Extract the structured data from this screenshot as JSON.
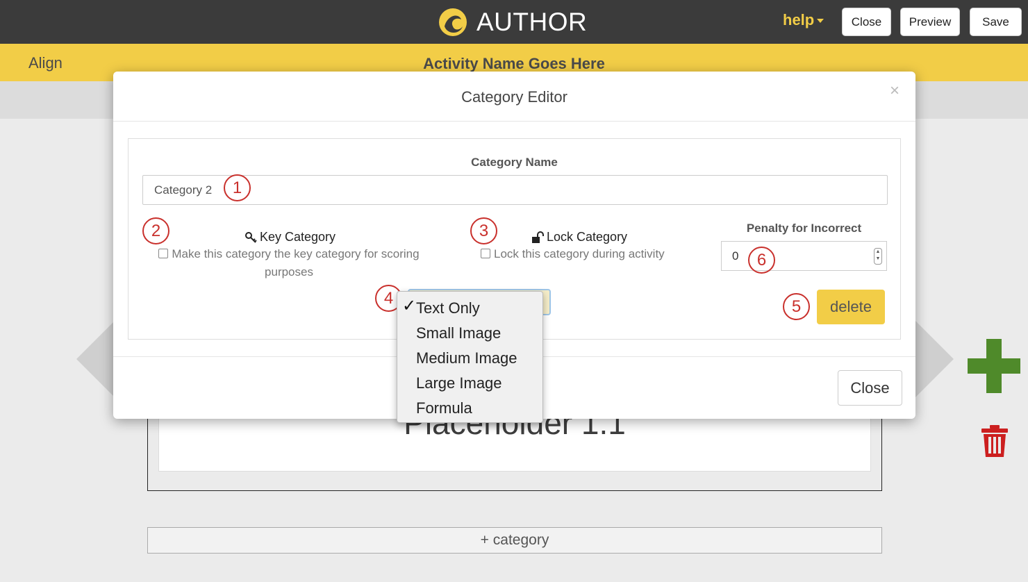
{
  "header": {
    "brand": "AUTHOR",
    "help_label": "help",
    "buttons": {
      "close": "Close",
      "preview": "Preview",
      "save": "Save"
    },
    "accent_color": "#f2cd47"
  },
  "subheader": {
    "app_label": "Align",
    "activity_name": "Activity Name Goes Here"
  },
  "background": {
    "placeholder_text": "Placeholder 1.1",
    "add_category_label": "+ category"
  },
  "modal": {
    "title": "Category Editor",
    "close_x": "×",
    "category_name_label": "Category Name",
    "category_name_value": "Category 2",
    "key_category": {
      "title": "Key Category",
      "description": "Make this category the key category for scoring purposes",
      "checked": false
    },
    "lock_category": {
      "title": "Lock Category",
      "description": "Lock this category during activity",
      "checked": false
    },
    "penalty": {
      "label": "Penalty for Incorrect",
      "value": "0"
    },
    "delete_label": "delete",
    "close_label": "Close",
    "content_type_dropdown": {
      "selected": "Text Only",
      "check_mark": "✓",
      "options": [
        "Text Only",
        "Small Image",
        "Medium Image",
        "Large Image",
        "Formula"
      ]
    },
    "callouts": [
      "1",
      "2",
      "3",
      "4",
      "5",
      "6"
    ]
  }
}
